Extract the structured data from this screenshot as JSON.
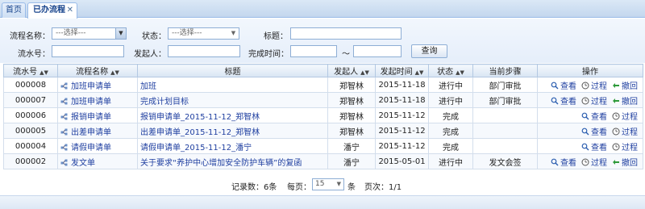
{
  "tabs": {
    "home_label": "首页",
    "active_label": "已办流程",
    "close_glyph": "✕"
  },
  "form": {
    "flow_name_label": "流程名称：",
    "flow_name_value": "---选择---",
    "status_label": "状态：",
    "status_value": "---选择---",
    "title_label": "标题：",
    "title_value": "",
    "serial_label": "流水号：",
    "serial_value": "",
    "initiator_label": "发起人：",
    "initiator_value": "",
    "finish_time_label": "完成时间：",
    "finish_time_from": "",
    "range_sep": "～",
    "finish_time_to": "",
    "query_button": "查询"
  },
  "grid": {
    "columns": [
      "流水号",
      "流程名称",
      "标题",
      "发起人",
      "发起时间",
      "状态",
      "当前步骤",
      "操作"
    ],
    "rows": [
      {
        "serial": "000008",
        "flow": "加班申请单",
        "title": "加班",
        "initiator": "郑智林",
        "time": "2015-11-18",
        "status": "进行中",
        "step": "部门审批",
        "ops": [
          "查看",
          "过程",
          "撤回"
        ]
      },
      {
        "serial": "000007",
        "flow": "加班申请单",
        "title": "完成计划目标",
        "initiator": "郑智林",
        "time": "2015-11-18",
        "status": "进行中",
        "step": "部门审批",
        "ops": [
          "查看",
          "过程",
          "撤回"
        ]
      },
      {
        "serial": "000006",
        "flow": "报销申请单",
        "title": "报销申请单_2015-11-12_郑智林",
        "initiator": "郑智林",
        "time": "2015-11-12",
        "status": "完成",
        "step": "",
        "ops": [
          "查看",
          "过程"
        ]
      },
      {
        "serial": "000005",
        "flow": "出差申请单",
        "title": "出差申请单_2015-11-12_郑智林",
        "initiator": "郑智林",
        "time": "2015-11-12",
        "status": "完成",
        "step": "",
        "ops": [
          "查看",
          "过程"
        ]
      },
      {
        "serial": "000004",
        "flow": "请假申请单",
        "title": "请假申请单_2015-11-12_潘宁",
        "initiator": "潘宁",
        "time": "2015-11-12",
        "status": "完成",
        "step": "",
        "ops": [
          "查看",
          "过程"
        ]
      },
      {
        "serial": "000002",
        "flow": "发文单",
        "title": "关于要求“养护中心增加安全防护车辆”的复函",
        "initiator": "潘宁",
        "time": "2015-05-01",
        "status": "进行中",
        "step": "发文会签",
        "ops": [
          "查看",
          "过程",
          "撤回"
        ]
      }
    ]
  },
  "footer": {
    "record_count": "记录数：6条",
    "per_page_label": "每页：",
    "per_page_value": "15",
    "per_page_unit": "条",
    "page_info": "页次：1/1"
  },
  "colors": {
    "accent": "#1f3fa0",
    "header_bg": "#d9e5f3",
    "border": "#99bbe8"
  }
}
